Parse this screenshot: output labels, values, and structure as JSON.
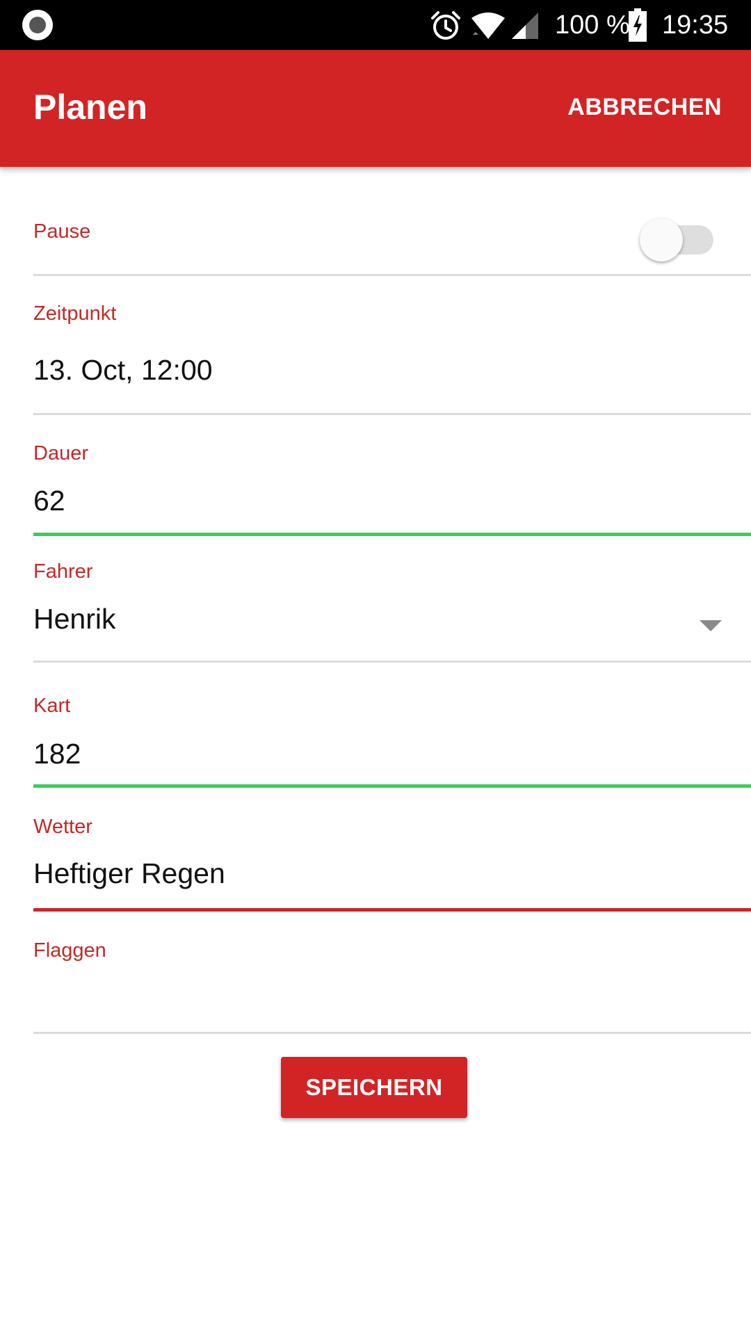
{
  "status_bar": {
    "battery_text": "100 %",
    "time": "19:35",
    "icons": [
      "record-icon",
      "alarm-icon",
      "wifi-icon",
      "signal-icon",
      "battery-charging-icon"
    ]
  },
  "appbar": {
    "title": "Planen",
    "cancel_label": "ABBRECHEN"
  },
  "form": {
    "pause": {
      "label": "Pause",
      "toggle_on": false
    },
    "zeitpunkt": {
      "label": "Zeitpunkt",
      "value": "13. Oct, 12:00"
    },
    "dauer": {
      "label": "Dauer",
      "value": "62",
      "state": "valid"
    },
    "fahrer": {
      "label": "Fahrer",
      "value": "Henrik"
    },
    "kart": {
      "label": "Kart",
      "value": "182",
      "state": "valid"
    },
    "wetter": {
      "label": "Wetter",
      "value": "Heftiger Regen",
      "state": "focused"
    },
    "flaggen": {
      "label": "Flaggen",
      "value": ""
    }
  },
  "actions": {
    "save_label": "SPEICHERN"
  },
  "colors": {
    "primary": "#d32425",
    "label": "#c62828",
    "valid": "#3dcb5f",
    "divider": "#dcdcdc"
  }
}
